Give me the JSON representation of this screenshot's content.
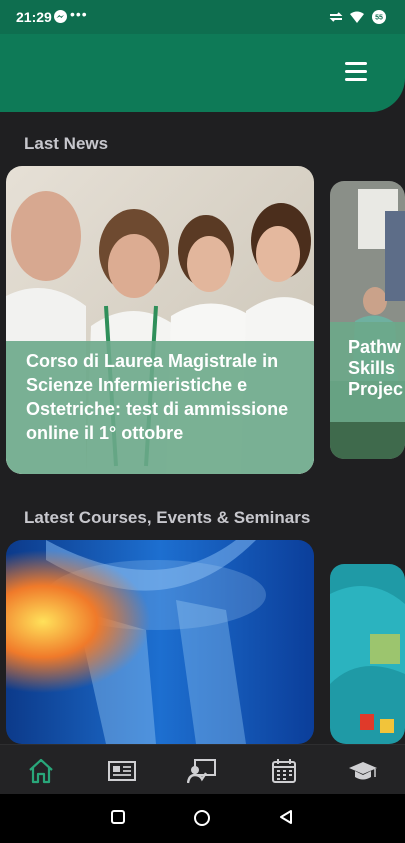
{
  "status_bar": {
    "time": "21:29",
    "dots": "•••",
    "battery": "55"
  },
  "header": {
    "menu_icon": "hamburger-menu-icon"
  },
  "sections": {
    "news": {
      "title": "Last News",
      "cards": [
        {
          "title": "Corso di Laurea Magistrale in Scienze Infermieristiche e Ostetriche: test di ammissione online il 1° ottobre"
        },
        {
          "title": "Pathw\nSkills\nProjec"
        }
      ]
    },
    "courses": {
      "title": "Latest Courses, Events & Seminars"
    }
  },
  "tabs": [
    {
      "name": "home-icon",
      "active": true
    },
    {
      "name": "news-icon"
    },
    {
      "name": "courses-icon"
    },
    {
      "name": "calendar-icon"
    },
    {
      "name": "graduation-cap-icon"
    }
  ],
  "colors": {
    "accent": "#0e7a57",
    "tab_active": "#29a77a",
    "caption_bg": "#6ca88a"
  }
}
